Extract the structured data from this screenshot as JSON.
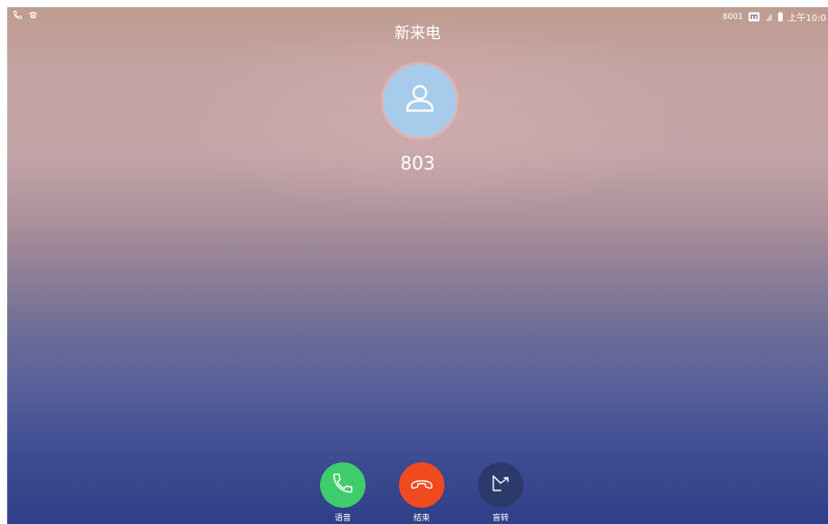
{
  "status_bar": {
    "extension": "8001",
    "time": "上午10:0",
    "icons": [
      "phone-handset-icon",
      "voicemail-icon",
      "network-icon",
      "wifi-icon",
      "battery-icon"
    ]
  },
  "call": {
    "title": "新来电",
    "caller": "803",
    "avatar_icon": "person-icon"
  },
  "actions": [
    {
      "label": "语音",
      "icon": "phone-answer-icon",
      "color": "#3fcd6b"
    },
    {
      "label": "结束",
      "icon": "phone-hangup-icon",
      "color": "#f24a1f"
    },
    {
      "label": "盲转",
      "icon": "transfer-arrow-icon",
      "color": "#2c3a6b"
    }
  ]
}
